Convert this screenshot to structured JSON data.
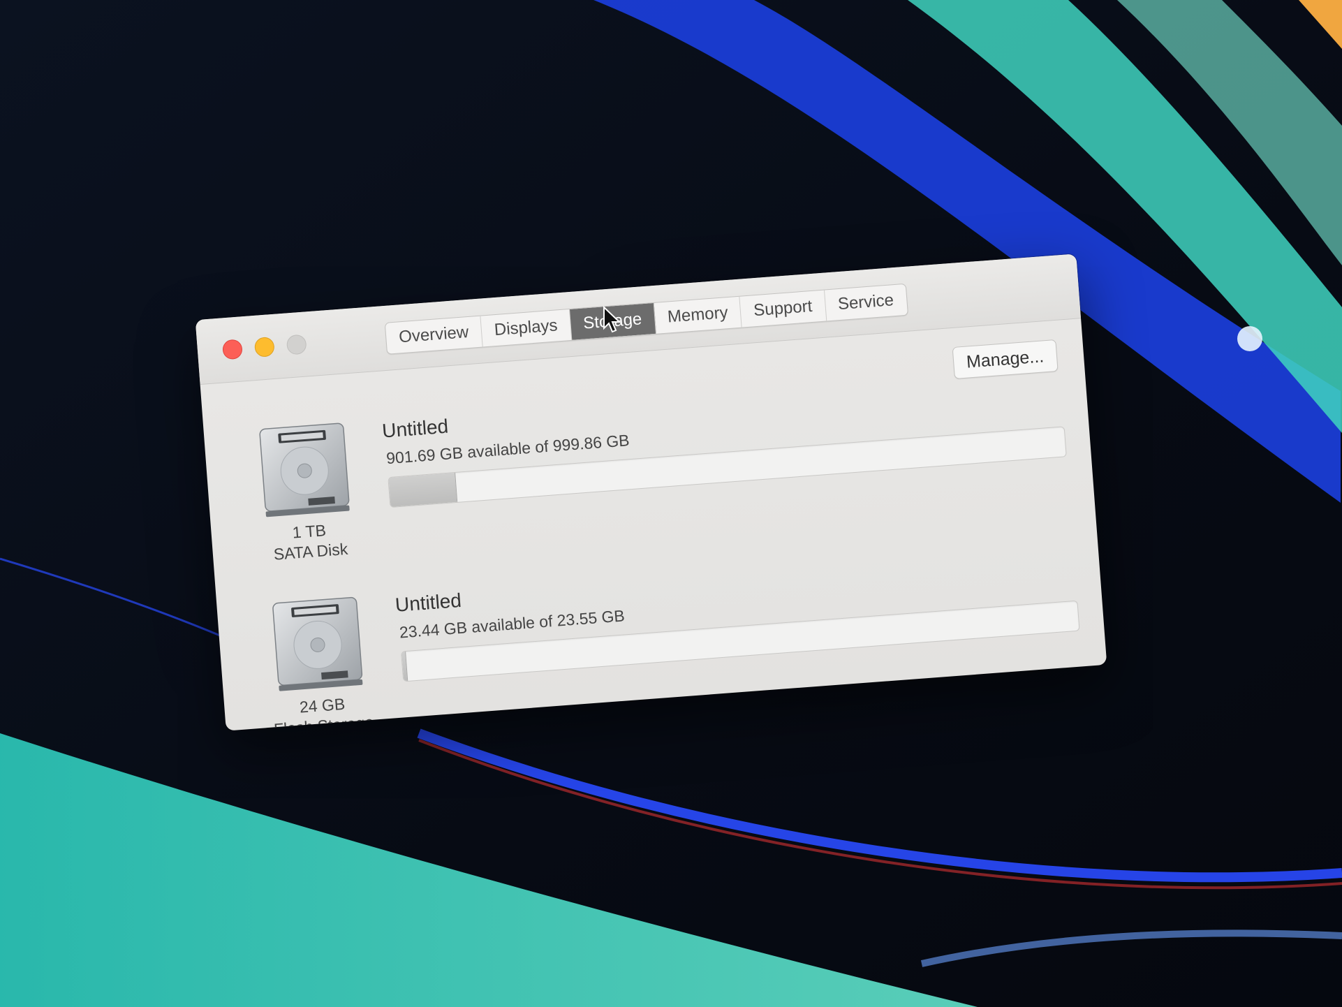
{
  "window": {
    "tabs": [
      "Overview",
      "Displays",
      "Storage",
      "Memory",
      "Support",
      "Service"
    ],
    "selected_tab": "Storage",
    "manage_label": "Manage..."
  },
  "disks": [
    {
      "icon": "hard-disk-icon",
      "capacity": "1 TB",
      "type": "SATA Disk",
      "volume_name": "Untitled",
      "availability": "901.69 GB available of 999.86 GB",
      "used_fraction": 0.098
    },
    {
      "icon": "hard-disk-icon",
      "capacity": "24 GB",
      "type": "Flash Storage",
      "volume_name": "Untitled",
      "availability": "23.44 GB available of 23.55 GB",
      "used_fraction": 0.005
    }
  ],
  "colors": {
    "close": "#fc5f57",
    "minimize": "#fdbc2e",
    "zoom_disabled": "#d2d1cf",
    "selected_tab": "#6c6c6c"
  }
}
